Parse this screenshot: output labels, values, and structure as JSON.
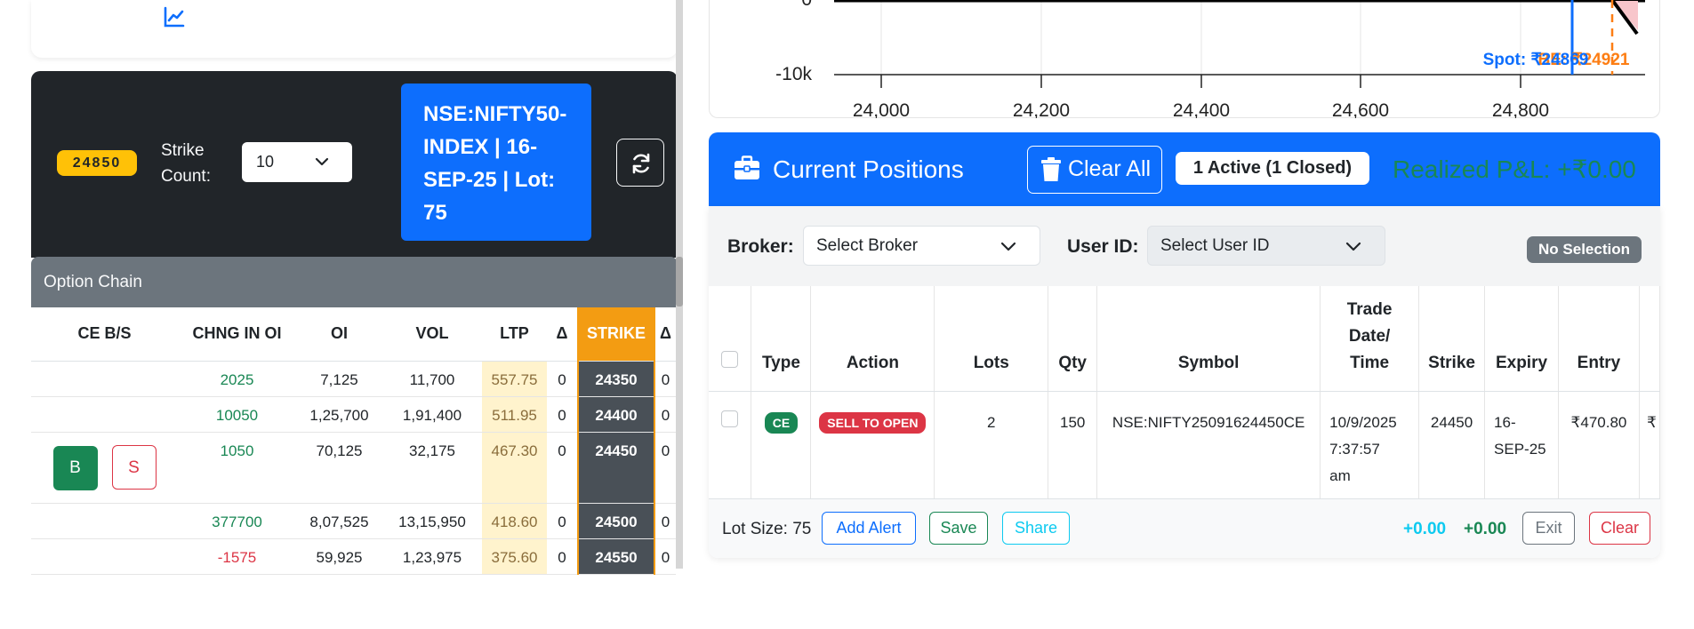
{
  "option_chain": {
    "spot_badge": "24850",
    "strike_count_label": "Strike Count:",
    "strike_count_value": "10",
    "instrument_info": "NSE:NIFTY50-INDEX | 16-SEP-25 | Lot: 75",
    "header_title": "Option Chain",
    "columns": [
      "CE B/S",
      "CHNG IN OI",
      "OI",
      "VOL",
      "LTP",
      "Δ",
      "STRIKE",
      "Δ"
    ],
    "buy_label": "B",
    "sell_label": "S",
    "rows": [
      {
        "chng_oi": "2025",
        "oi": "7,125",
        "vol": "11,700",
        "ltp": "557.75",
        "delta": "0",
        "strike": "24350",
        "delta2": "0"
      },
      {
        "chng_oi": "10050",
        "oi": "1,25,700",
        "vol": "1,91,400",
        "ltp": "511.95",
        "delta": "0",
        "strike": "24400",
        "delta2": "0"
      },
      {
        "chng_oi": "1050",
        "oi": "70,125",
        "vol": "32,175",
        "ltp": "467.30",
        "delta": "0",
        "strike": "24450",
        "delta2": "0"
      },
      {
        "chng_oi": "377700",
        "oi": "8,07,525",
        "vol": "13,15,950",
        "ltp": "418.60",
        "delta": "0",
        "strike": "24500",
        "delta2": "0"
      },
      {
        "chng_oi": "-1575",
        "oi": "59,925",
        "vol": "1,23,975",
        "ltp": "375.60",
        "delta": "0",
        "strike": "24550",
        "delta2": "0"
      }
    ]
  },
  "payoff_chart": {
    "y_ticks": [
      "0",
      "-10k"
    ],
    "x_ticks": [
      "24,000",
      "24,200",
      "24,400",
      "24,600",
      "24,800"
    ],
    "spot_label": "Spot: ₹24869",
    "breakeven_label": "BE: ₹24921"
  },
  "positions": {
    "title": "Current Positions",
    "clear_all_label": "Clear All",
    "active_badge": "1 Active (1 Closed)",
    "realized_pnl": "Realized P&L: +₹0.00",
    "broker_label": "Broker:",
    "broker_placeholder": "Select Broker",
    "userid_label": "User ID:",
    "userid_placeholder": "Select User ID",
    "selection_badge": "No Selection",
    "columns": {
      "type": "Type",
      "action": "Action",
      "lots": "Lots",
      "qty": "Qty",
      "symbol": "Symbol",
      "trade_date_1": "Trade",
      "trade_date_2": "Date/",
      "trade_date_3": "Time",
      "strike": "Strike",
      "expiry": "Expiry",
      "entry": "Entry"
    },
    "row": {
      "type": "CE",
      "action": "SELL TO OPEN",
      "lots": "2",
      "qty": "150",
      "symbol": "NSE:NIFTY25091624450CE",
      "trade_date_1": "10/9/2025",
      "trade_date_2": "7:37:57",
      "trade_date_3": "am",
      "strike": "24450",
      "expiry_1": "16-",
      "expiry_2": "SEP-25",
      "entry": "₹470.80",
      "partial": "₹"
    },
    "footer": {
      "lot_size": "Lot Size: 75",
      "add_alert": "Add Alert",
      "save": "Save",
      "share": "Share",
      "pnl_1": "+0.00",
      "pnl_2": "+0.00",
      "exit": "Exit",
      "clear": "Clear"
    }
  },
  "colors": {
    "primary": "#0d6efd",
    "success": "#198754",
    "danger": "#dc3545",
    "warning": "#ffc107",
    "strike_header": "#f39c12",
    "dark": "#212529"
  },
  "icons": [
    "chart-line-icon",
    "chevron-down-icon",
    "refresh-icon",
    "briefcase-icon",
    "trash-icon"
  ]
}
